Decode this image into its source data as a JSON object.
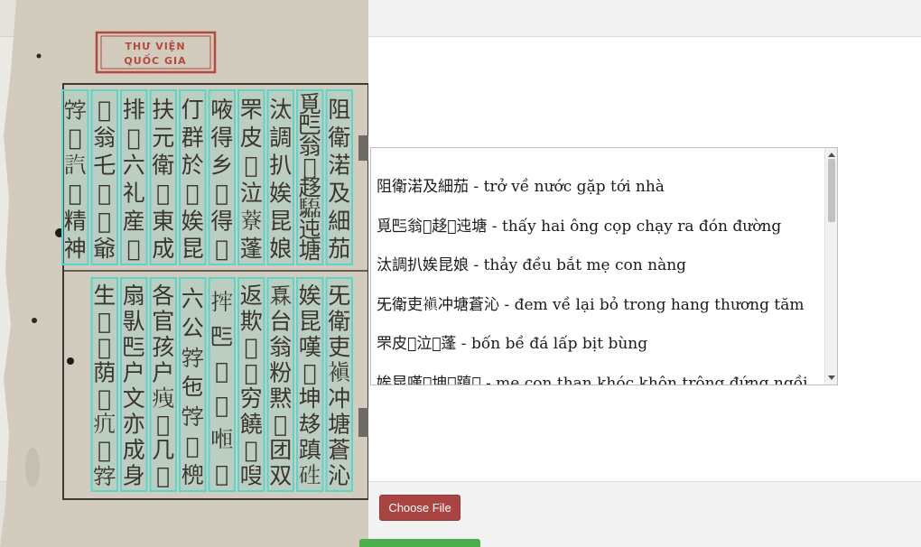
{
  "scan": {
    "seal_line1": "THƯ VIỆN",
    "seal_line2": "QUỐC GIA",
    "upper_columns": [
      "阻衛渃及細茄",
      "覓𠀧翁𤠄趍𩧍迍塘",
      "汰調扒娭昆娘",
      "罘皮𢬗泣𦼔蓬",
      "㖡得乡𡛔得𣋀",
      "仃群於𥚄娭昆",
      "扶元衛𦁂東成",
      "排𨂔六礼産𫇰",
      "𡛔翁乇𫁰𡛔爺",
      "𡨸𩛄𧥷𡞕精神"
    ],
    "lower_columns": [
      "旡衛吏𧜖冲塘蒼沁",
      "娭昆嘆𠸗坤𠫾蹎𥑥",
      "𤾓台翁粉黙𠻀团双",
      "返欺𢜠𦋦穷饒𨁮㖬",
      "𢭂𠀧𢬗𠻃𠷐𩛷",
      "六公𡦂㐌𡨸𣋀𣘛",
      "各官孩户𤵺𩆍几𡞕",
      "扇𠊛𠀧户文亦成身",
      "生𠊚𢬣荫𨁪𤴪𡗉𡦂"
    ]
  },
  "transcription": {
    "lines": [
      {
        "han": "阻衛渃及細茄",
        "sep": " - ",
        "viet": "trở về nước gặp tới nhà"
      },
      {
        "han": "覓𠀧翁𤠄趍𩧍迍塘",
        "sep": " - ",
        "viet": "thấy hai ông cọp chạy ra đón đường"
      },
      {
        "han": "汰調扒娭昆娘",
        "sep": " - ",
        "viet": "thảy đều bắt mẹ con nàng"
      },
      {
        "han": "旡衛吏𧜖冲塘蒼沁",
        "sep": " - ",
        "viet": "đem về lại bỏ trong hang thương tăm"
      },
      {
        "han": "罘皮𢬗泣𦼔蓬",
        "sep": " - ",
        "viet": "bốn bề đá lấp bịt bùng"
      },
      {
        "han": "娭昆嘆𠸗坤𠫾蹎𥑥",
        "sep": " - ",
        "viet": "mẹ con than khóc khôn trông đứng ngồi"
      }
    ]
  },
  "controls": {
    "choose_file_label": "Choose File"
  },
  "colors": {
    "paper": "#d6d0c4",
    "overlay": "#58d6cc",
    "seal": "#b54a3c",
    "choose_button": "#a94442",
    "upload_button": "#4cae4c"
  }
}
